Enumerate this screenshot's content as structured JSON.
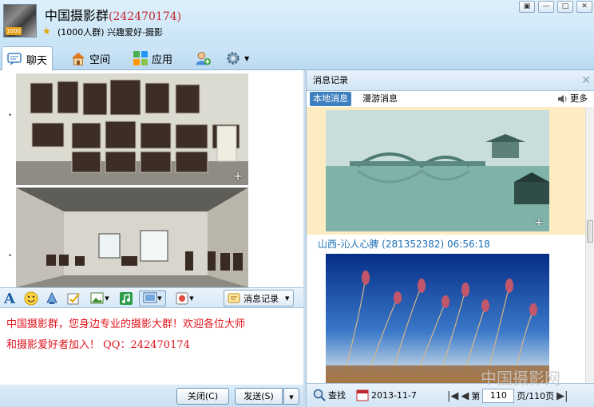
{
  "window": {
    "group_name": "中国摄影群",
    "group_id": "(242470174)",
    "group_desc": "(1000人群) 兴趣爱好-摄影",
    "avatar_badge": "1000",
    "buttons": [
      "▣",
      "—",
      "□",
      "✕"
    ]
  },
  "nav": {
    "tabs": [
      {
        "label": "聊天",
        "icon": "chat-icon"
      },
      {
        "label": "空间",
        "icon": "home-icon"
      },
      {
        "label": "应用",
        "icon": "apps-icon"
      }
    ],
    "add_member_icon": "add-member-icon",
    "settings_icon": "gear-icon"
  },
  "chat": {
    "bullets": [
      "•",
      "•"
    ]
  },
  "toolbar": {
    "history_label": "消息记录"
  },
  "compose": {
    "text_line1": "中国摄影群，您身边专业的摄影大群！欢迎各位大师",
    "text_line2": "和摄影爱好者加入！ QQ：242470174"
  },
  "actions": {
    "close_label": "关闭(C)",
    "send_label": "发送(S)"
  },
  "history": {
    "title": "消息记录",
    "tab_local": "本地消息",
    "tab_roam": "漫游消息",
    "more_label": "更多",
    "sender": "山西-沁人心脾 (281352382) 06:56:18",
    "find_label": "查找",
    "date": "2013-11-7",
    "page_prefix": "第",
    "page_number": "110",
    "page_suffix": "页/110页"
  },
  "watermark": "中国摄影网",
  "colors": {
    "accent_blue": "#3d7fbf",
    "compose_red": "#e0141e",
    "group_id_red": "#c0272d",
    "highlight": "#fdebc2"
  }
}
